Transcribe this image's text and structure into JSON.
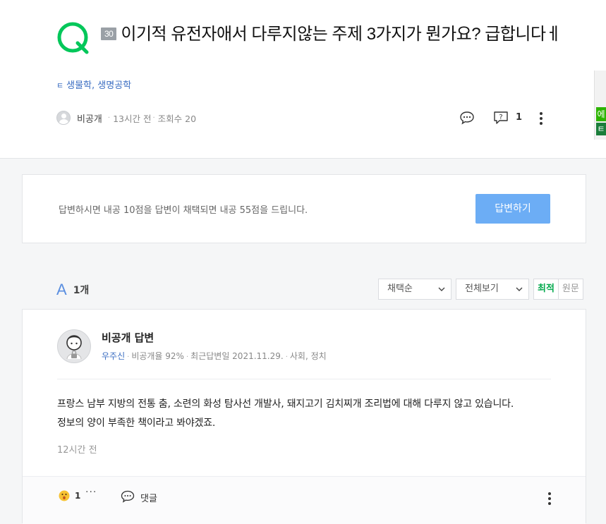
{
  "question": {
    "points_badge": "30",
    "title": "이기적 유전자애서 다루지않는 주제 3가지가 뭔가요? 급합니다ㅔ",
    "categories": "생물학, 생명공학",
    "category_icon": "ㅌ",
    "author": "비공개",
    "posted_ago": "13시간 전",
    "views": "조회수 20",
    "answer_count": "1"
  },
  "side_ad": {
    "char1": "에",
    "char2": "ㅌ"
  },
  "answer_prompt": {
    "text": "답변하시면 내공 10점을 답변이 채택되면 내공 55점을 드립니다.",
    "button_label": "답변하기"
  },
  "answers_header": {
    "letter": "A",
    "count": "1개",
    "sort_select": "채택순",
    "filter_select": "전체보기",
    "tab_latest": "최적",
    "tab_original": "원문"
  },
  "answer": {
    "author": "비공개 답변",
    "grade": "우주신",
    "private_rate": "비공개율 92%",
    "last_answer": "최근답변일 2021.11.29.",
    "fields": "사회, 정치",
    "body_line1": "프랑스 남부 지방의 전통 춤, 소련의 화성 탐사선 개발사, 돼지고기 김치찌개 조리법에 대해 다루지 않고 있습니다.",
    "body_line2": "정보의 양이 부족한 책이라고 봐야겠죠.",
    "time": "12시간 전",
    "reaction_count": "1",
    "more": "···",
    "comment_label": "댓글"
  },
  "colors": {
    "brand_green": "#03c75a",
    "link_blue": "#3b6ec2",
    "button_blue": "#6cadf5"
  }
}
